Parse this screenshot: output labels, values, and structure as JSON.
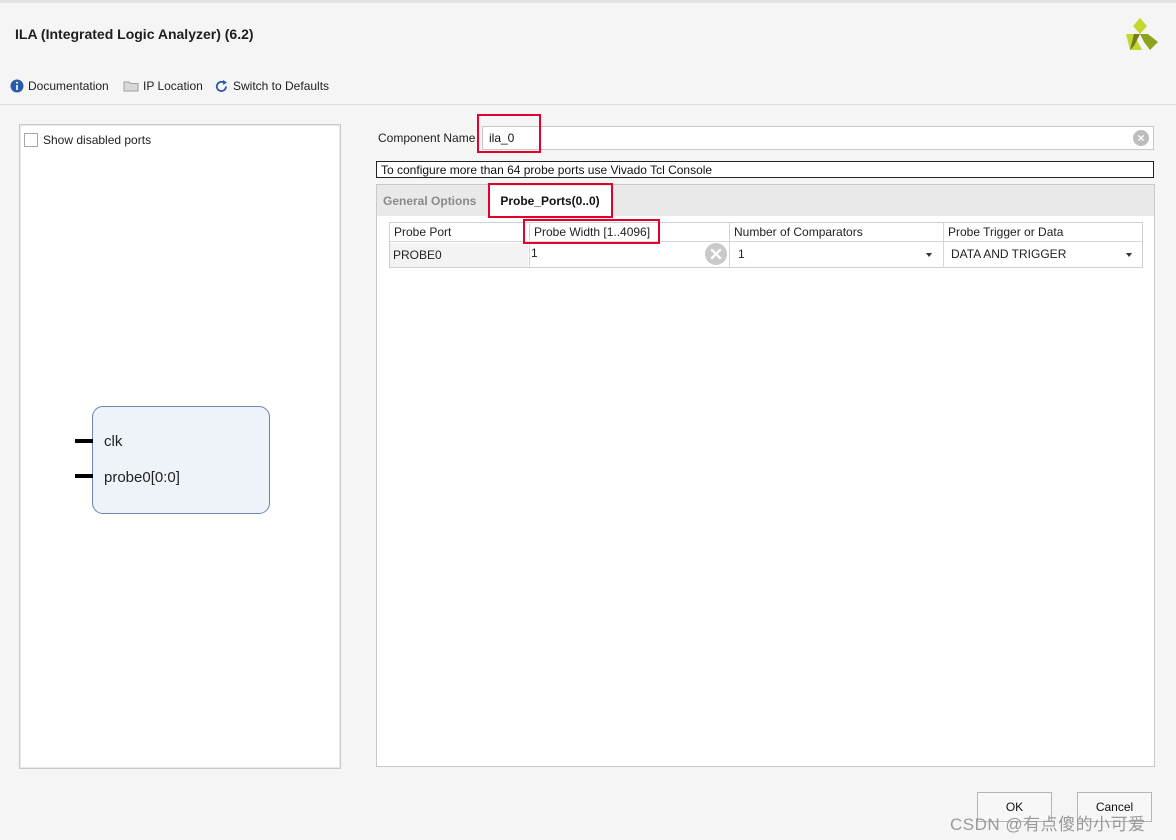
{
  "window": {
    "title": "ILA (Integrated Logic Analyzer) (6.2)"
  },
  "toolbar": {
    "documentation": "Documentation",
    "ip_location": "IP Location",
    "switch_defaults": "Switch to Defaults"
  },
  "left_panel": {
    "show_disabled_ports": "Show disabled ports",
    "show_disabled_checked": false,
    "ports": [
      "clk",
      "probe0[0:0]"
    ]
  },
  "component": {
    "label": "Component Name",
    "value": "ila_0"
  },
  "info_message": "To configure more than 64 probe ports use Vivado Tcl Console",
  "tabs": [
    {
      "label": "General Options",
      "active": false
    },
    {
      "label": "Probe_Ports(0..0)",
      "active": true
    }
  ],
  "probe_table": {
    "columns": [
      "Probe Port",
      "Probe Width [1..4096]",
      "Number of Comparators",
      "Probe Trigger or Data"
    ],
    "rows": [
      {
        "port": "PROBE0",
        "width": "1",
        "comparators": "1",
        "trigger": "DATA AND TRIGGER"
      }
    ]
  },
  "buttons": {
    "ok": "OK",
    "cancel": "Cancel"
  },
  "watermark": "CSDN @有点傻的小可爱",
  "colors": {
    "highlight_red": "#e4002b",
    "logo_yellow": "#c5d631",
    "logo_olive": "#6f7d1f",
    "block_fill": "#eef2f9",
    "block_border": "#6b86b4"
  }
}
